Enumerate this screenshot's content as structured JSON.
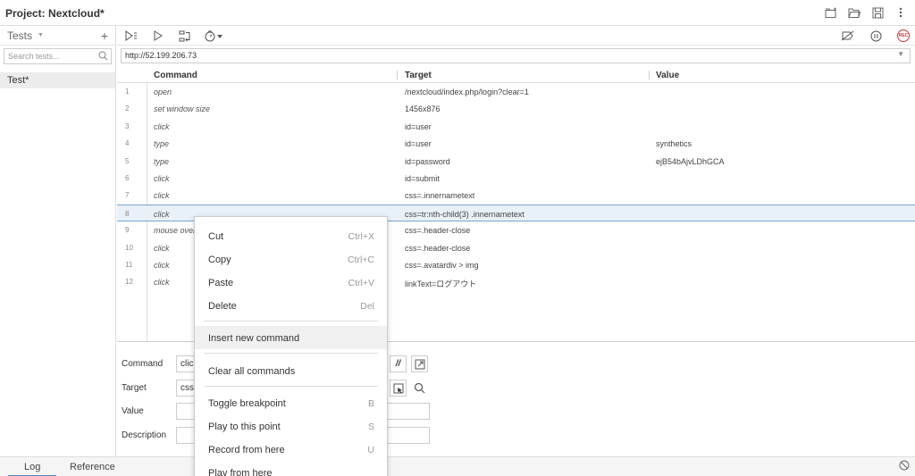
{
  "header": {
    "project_label": "Project:",
    "project_name": "Nextcloud*"
  },
  "sidebar": {
    "tests_label": "Tests",
    "add_label": "+",
    "search_placeholder": "Search tests...",
    "test_item": "Test*"
  },
  "url": "http://52.199.206.73",
  "table": {
    "headers": {
      "command": "Command",
      "target": "Target",
      "value": "Value"
    },
    "rows": [
      {
        "num": "1",
        "command": "open",
        "target": "/nextcloud/index.php/login?clear=1",
        "value": ""
      },
      {
        "num": "2",
        "command": "set window size",
        "target": "1456x876",
        "value": ""
      },
      {
        "num": "3",
        "command": "click",
        "target": "id=user",
        "value": ""
      },
      {
        "num": "4",
        "command": "type",
        "target": "id=user",
        "value": "synthetics"
      },
      {
        "num": "5",
        "command": "type",
        "target": "id=password",
        "value": "ejB54bAjvLDhGCA"
      },
      {
        "num": "6",
        "command": "click",
        "target": "id=submit",
        "value": ""
      },
      {
        "num": "7",
        "command": "click",
        "target": "css=.innernametext",
        "value": ""
      },
      {
        "num": "8",
        "command": "click",
        "target": "css=tr:nth-child(3) .innernametext",
        "value": ""
      },
      {
        "num": "9",
        "command": "mouse over",
        "target": "css=.header-close",
        "value": ""
      },
      {
        "num": "10",
        "command": "click",
        "target": "css=.header-close",
        "value": ""
      },
      {
        "num": "11",
        "command": "click",
        "target": "css=.avatardiv > img",
        "value": ""
      },
      {
        "num": "12",
        "command": "click",
        "target": "linkText=ログアウト",
        "value": ""
      }
    ]
  },
  "form": {
    "command_label": "Command",
    "command_value": "click",
    "target_label": "Target",
    "target_value": "css=",
    "value_label": "Value",
    "description_label": "Description",
    "comment_btn": "//"
  },
  "bottom": {
    "log_tab": "Log",
    "reference_tab": "Reference"
  },
  "context_menu": {
    "cut": "Cut",
    "cut_sc": "Ctrl+X",
    "copy": "Copy",
    "copy_sc": "Ctrl+C",
    "paste": "Paste",
    "paste_sc": "Ctrl+V",
    "delete": "Delete",
    "delete_sc": "Del",
    "insert": "Insert new command",
    "clear": "Clear all commands",
    "toggle_bp": "Toggle breakpoint",
    "toggle_bp_sc": "B",
    "play_to": "Play to this point",
    "play_to_sc": "S",
    "record_from": "Record from here",
    "record_from_sc": "U",
    "play_from": "Play from here"
  },
  "colors": {
    "selection_bg": "#e8f0f8",
    "selection_border": "#7aa6d0",
    "record_red": "#cc3333",
    "active_tab": "#4a8ad4"
  }
}
